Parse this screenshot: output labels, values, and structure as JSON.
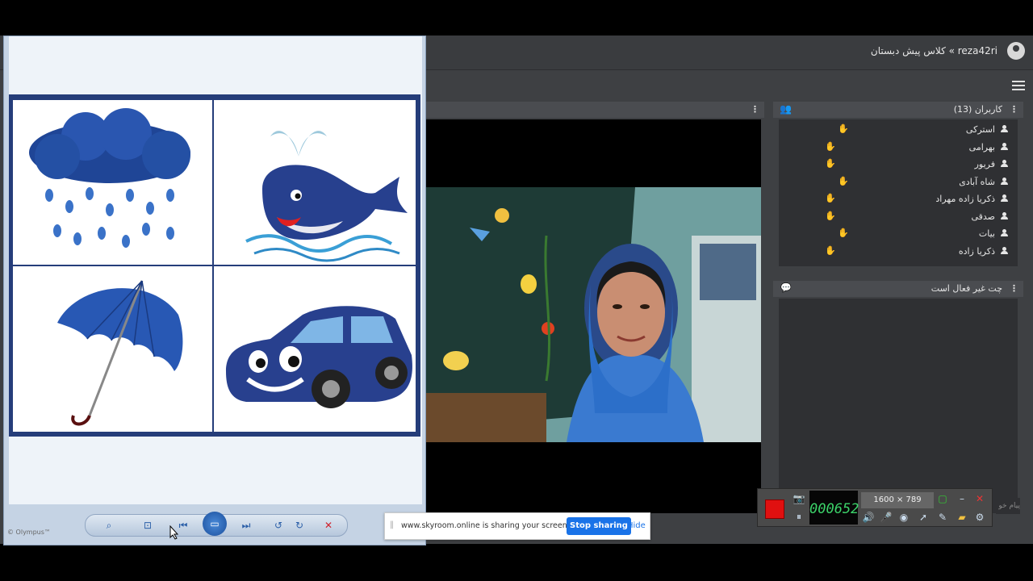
{
  "header": {
    "breadcrumb": "reza42ri » کلاس پیش دبستان",
    "account_icon": "account-circle-icon",
    "menu_icon": "hamburger-menu-icon"
  },
  "users_panel": {
    "title": "کاربران (13)",
    "users": [
      "استرکی",
      "بهرامی",
      "فریور",
      "شاه آبادی",
      "ذکریا زاده مهراد",
      "صدقی",
      "بیات",
      "ذکریا زاده"
    ]
  },
  "chat_panel": {
    "title": "چت غیر فعال است",
    "input_placeholder": "پیام خو"
  },
  "share_bar": {
    "message": "www.skyroom.online is sharing your screen.",
    "stop_label": "Stop sharing",
    "hide_label": "Hide"
  },
  "recorder": {
    "timer": "000652",
    "resolution": "1600 × 789"
  },
  "viewer": {
    "footer": "© Olympus™"
  },
  "colors": {
    "accent_blue": "#1a73e8",
    "record_red": "#e01010",
    "timer_green": "#3cd46a",
    "app_bg": "#3e4043"
  }
}
